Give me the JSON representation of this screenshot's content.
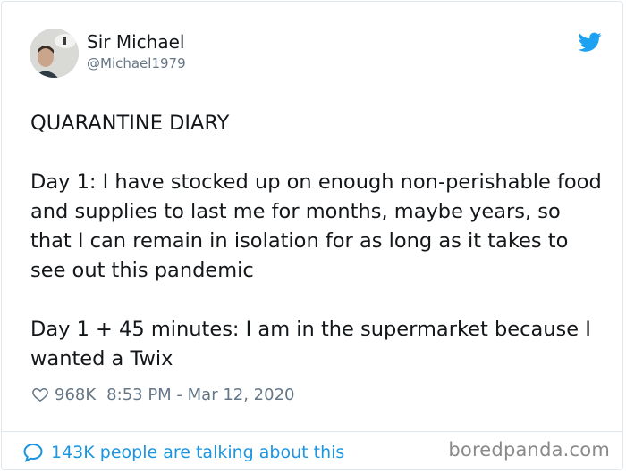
{
  "author": {
    "display_name": "Sir Michael",
    "handle": "@Michael1979"
  },
  "icons": {
    "brand": "twitter-bird-icon",
    "like": "heart-icon",
    "conversation": "speech-bubble-icon"
  },
  "colors": {
    "brand_blue": "#1da1f2",
    "link_blue": "#1b95e0",
    "text_primary": "#14171a",
    "text_secondary": "#657786"
  },
  "tweet": {
    "paragraphs": [
      "QUARANTINE DIARY",
      "Day 1: I have stocked up on enough non-perishable food and supplies to last me for months, maybe years, so that I can remain in isolation for as long as it takes to see out this pandemic",
      "Day 1 + 45 minutes: I am in the supermarket because I wanted a Twix"
    ],
    "likes": "968K",
    "timestamp": "8:53 PM - Mar 12, 2020"
  },
  "footer": {
    "conversation_text": "143K people are talking about this"
  },
  "watermark": "boredpanda.com"
}
